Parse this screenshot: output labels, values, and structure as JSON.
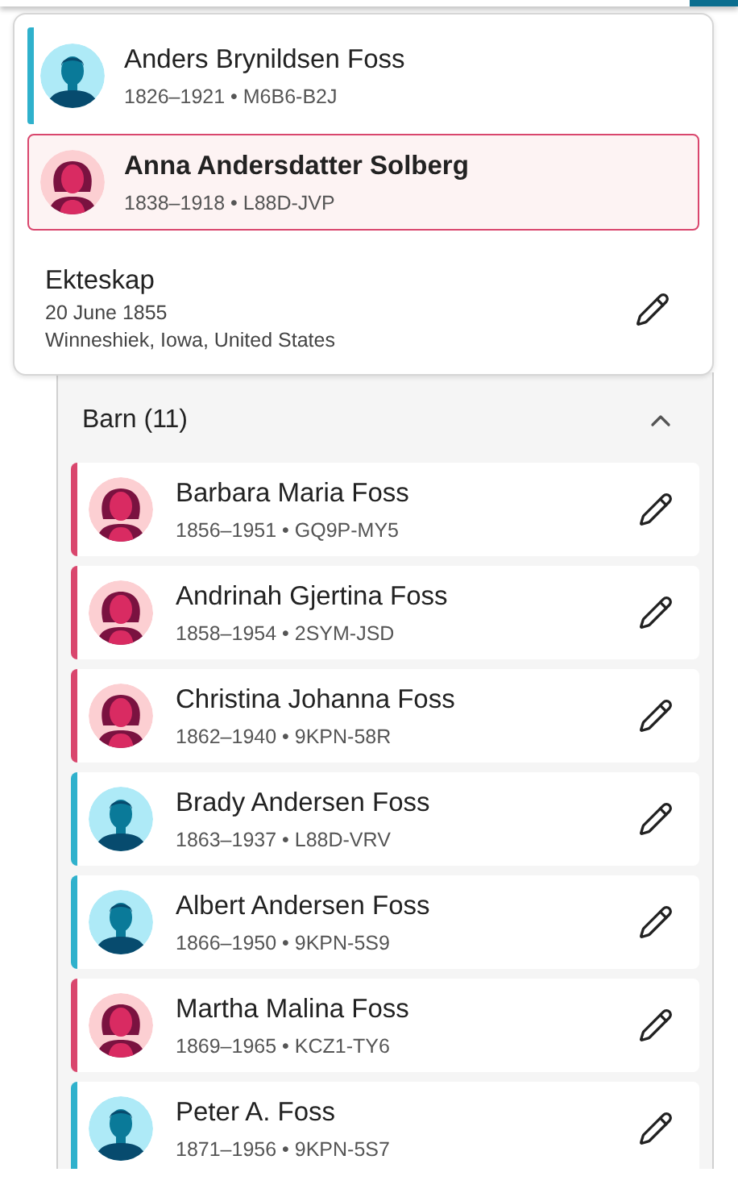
{
  "couple": {
    "parents": [
      {
        "name": "Anders Brynildsen Foss",
        "details": "1826–1921 • M6B6-B2J",
        "kind": "male",
        "selected": false
      },
      {
        "name": "Anna Andersdatter Solberg",
        "details": "1838–1918 • L88D-JVP",
        "kind": "female",
        "selected": true
      }
    ],
    "marriage": {
      "title": "Ekteskap",
      "date": "20 June 1855",
      "place": "Winneshiek, Iowa, United States"
    }
  },
  "children_section": {
    "title": "Barn (11)",
    "expanded": true,
    "children": [
      {
        "name": "Barbara Maria Foss",
        "details": "1856–1951 • GQ9P-MY5",
        "kind": "female"
      },
      {
        "name": "Andrinah Gjertina Foss",
        "details": "1858–1954 • 2SYM-JSD",
        "kind": "female"
      },
      {
        "name": "Christina Johanna Foss",
        "details": "1862–1940 • 9KPN-58R",
        "kind": "female"
      },
      {
        "name": "Brady Andersen Foss",
        "details": "1863–1937 • L88D-VRV",
        "kind": "male"
      },
      {
        "name": "Albert Andersen Foss",
        "details": "1866–1950 • 9KPN-5S9",
        "kind": "male"
      },
      {
        "name": "Martha Malina Foss",
        "details": "1869–1965 • KCZ1-TY6",
        "kind": "female"
      },
      {
        "name": "Peter A. Foss",
        "details": "1871–1956 • 9KPN-5S7",
        "kind": "male"
      }
    ]
  }
}
